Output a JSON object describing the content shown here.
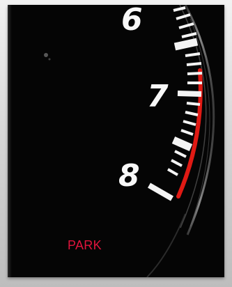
{
  "gauge": {
    "numerals": [
      "6",
      "7",
      "8"
    ],
    "redline_color": "#e01a14",
    "tick_color": "#f4f4f4",
    "numeral_color": "#f8f8f8"
  },
  "indicator": {
    "text": "PARK",
    "color": "#e0143c"
  }
}
